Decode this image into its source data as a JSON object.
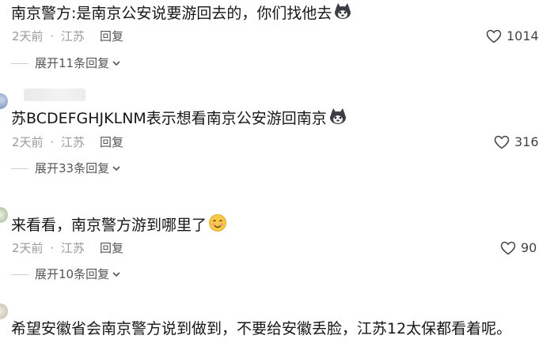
{
  "comments": [
    {
      "text": "南京警方:是南京公安说要游回去的，你们找他去",
      "time": "2天前",
      "location": "江苏",
      "reply_label": "回复",
      "likes": "1014",
      "expand_label": "展开11条回复"
    },
    {
      "text": "苏BCDEFGHJKLNM表示想看南京公安游回南京",
      "time": "2天前",
      "location": "江苏",
      "reply_label": "回复",
      "likes": "316",
      "expand_label": "展开33条回复"
    },
    {
      "text": "来看看，南京警方游到哪里了",
      "time": "2天前",
      "location": "江苏",
      "reply_label": "回复",
      "likes": "90",
      "expand_label": "展开10条回复"
    },
    {
      "text": "希望安徽省会南京警方说到做到，不要给安徽丢脸，江苏12太保都看着呢。"
    }
  ],
  "separator": "·",
  "icons": {
    "like": "heart-outline-icon",
    "expand": "chevron-down-icon",
    "emoji_cat": "husky-dog-emoji",
    "emoji_smile": "smiling-face-emoji"
  },
  "colors": {
    "text": "#161616",
    "meta": "#9a9a9a",
    "link": "#555555"
  }
}
